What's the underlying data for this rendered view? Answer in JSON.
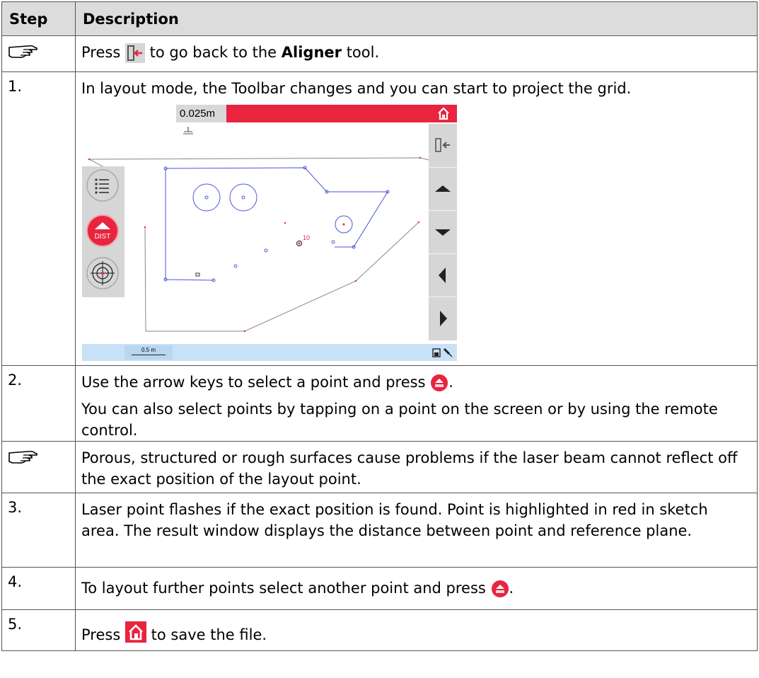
{
  "table": {
    "header_step": "Step",
    "header_description": "Description",
    "rows": [
      {
        "step": "",
        "kind": "hint",
        "parts": [
          "Press",
          "to go back to the",
          "Aligner",
          "tool."
        ]
      },
      {
        "step": "1.",
        "text": "In layout mode, the Toolbar changes and you can start to project the grid."
      },
      {
        "step": "2.",
        "text_a": "Use the arrow keys to select a point and press",
        "text_a_end": ".",
        "text_b": "You can also select points by tapping on a point on the screen or by using the remote control."
      },
      {
        "step": "",
        "kind": "hint",
        "text": "Porous, structured or rough surfaces cause problems if the laser beam cannot reflect off the exact position of the layout point."
      },
      {
        "step": "3.",
        "text": "Laser point flashes if the exact position is found. Point is highlighted in red in sketch area. The result window displays the distance between point and reference plane."
      },
      {
        "step": "4.",
        "text": "To layout further points select another point and press",
        "text_end": "."
      },
      {
        "step": "5.",
        "text_a": "Press",
        "text_b": "to save the file."
      }
    ]
  },
  "screenshot": {
    "distance_value": "0.025m",
    "scale_label": "0.5 m",
    "dist_button_label": "DIST",
    "point_label": "10",
    "accent_color": "#e8243f",
    "icons": [
      "hand-pointer-icon",
      "exit-icon",
      "home-icon",
      "list-icon",
      "dist-icon",
      "target-icon",
      "up-arrow-icon",
      "down-arrow-icon",
      "left-arrow-icon",
      "right-arrow-icon",
      "battery-icon",
      "laser-icon"
    ]
  }
}
